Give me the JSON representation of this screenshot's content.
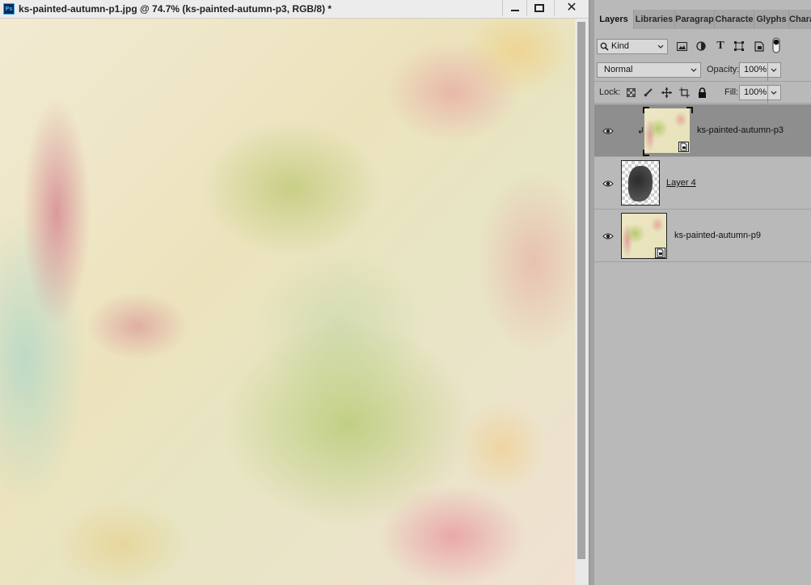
{
  "document": {
    "title": "ks-painted-autumn-p1.jpg @ 74.7% (ks-painted-autumn-p3, RGB/8) *",
    "app_logo": "Ps"
  },
  "panel": {
    "tabs": [
      {
        "label": "Layers",
        "active": true
      },
      {
        "label": "Libraries",
        "active": false
      },
      {
        "label": "Paragrap",
        "active": false
      },
      {
        "label": "Characte",
        "active": false
      },
      {
        "label": "Glyphs",
        "active": false
      },
      {
        "label": "Chara",
        "active": false
      }
    ],
    "filter": {
      "kind": "Kind"
    },
    "blend_mode": "Normal",
    "opacity_label": "Opacity:",
    "opacity_value": "100%",
    "lock_label": "Lock:",
    "fill_label": "Fill:",
    "fill_value": "100%",
    "layers": [
      {
        "name": "ks-painted-autumn-p3",
        "selected": true,
        "visible": true,
        "clipped": true,
        "smart_object": true
      },
      {
        "name": "Layer 4",
        "selected": false,
        "visible": true,
        "clipped": false,
        "smart_object": false
      },
      {
        "name": "ks-painted-autumn-p9",
        "selected": false,
        "visible": true,
        "clipped": false,
        "smart_object": true
      }
    ]
  },
  "icons": {
    "eye": "eye-icon",
    "search": "search-icon",
    "minimize": "minimize-icon",
    "maximize": "maximize-icon",
    "close": "close-icon"
  },
  "colors": {
    "panel_bg": "#b9b9b9",
    "selected_layer": "#8e8e8e",
    "ps_blue": "#31a8ff"
  }
}
